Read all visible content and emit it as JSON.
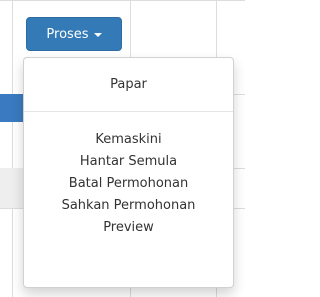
{
  "toggle": {
    "label": "Proses",
    "caret_icon": "caret-down-icon"
  },
  "menu": {
    "primary": [
      {
        "label": "Papar"
      }
    ],
    "secondary": [
      {
        "label": "Kemaskini"
      },
      {
        "label": "Hantar Semula"
      },
      {
        "label": "Batal Permohonan"
      },
      {
        "label": "Sahkan Permohonan"
      },
      {
        "label": "Preview"
      }
    ]
  },
  "colors": {
    "button_bg": "#337ab7",
    "button_border": "#2e6da4",
    "menu_text": "#333333"
  }
}
